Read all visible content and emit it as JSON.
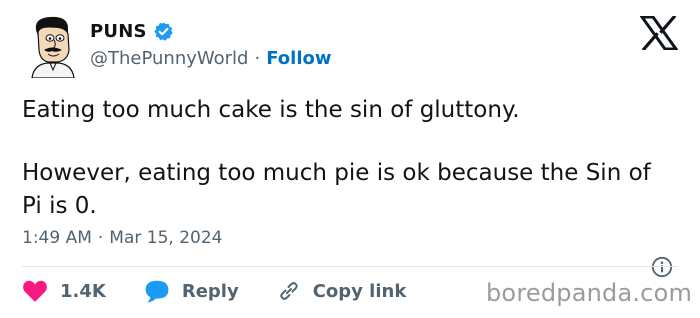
{
  "author": {
    "display_name": "PUNS",
    "handle": "@ThePunnyWorld",
    "separator": "·",
    "follow_label": "Follow"
  },
  "tweet": {
    "line1": "Eating too much cake is the sin of gluttony.",
    "line2": "However, eating too much pie is ok because the Sin of Pi is 0."
  },
  "meta": {
    "time": "1:49 AM",
    "separator": "·",
    "date": "Mar 15, 2024"
  },
  "actions": {
    "likes": "1.4K",
    "reply_label": "Reply",
    "copy_link_label": "Copy link"
  },
  "watermark": "boredpanda.com",
  "icons": {
    "verified": "verified-badge-icon",
    "x": "x-logo-icon",
    "info": "info-icon",
    "like": "heart-icon",
    "reply": "speech-bubble-icon",
    "link": "link-icon"
  },
  "colors": {
    "like": "#f91880",
    "reply": "#1d9bf0",
    "verified": "#1d9bf0",
    "follow": "#0072c6",
    "muted": "#536471"
  }
}
